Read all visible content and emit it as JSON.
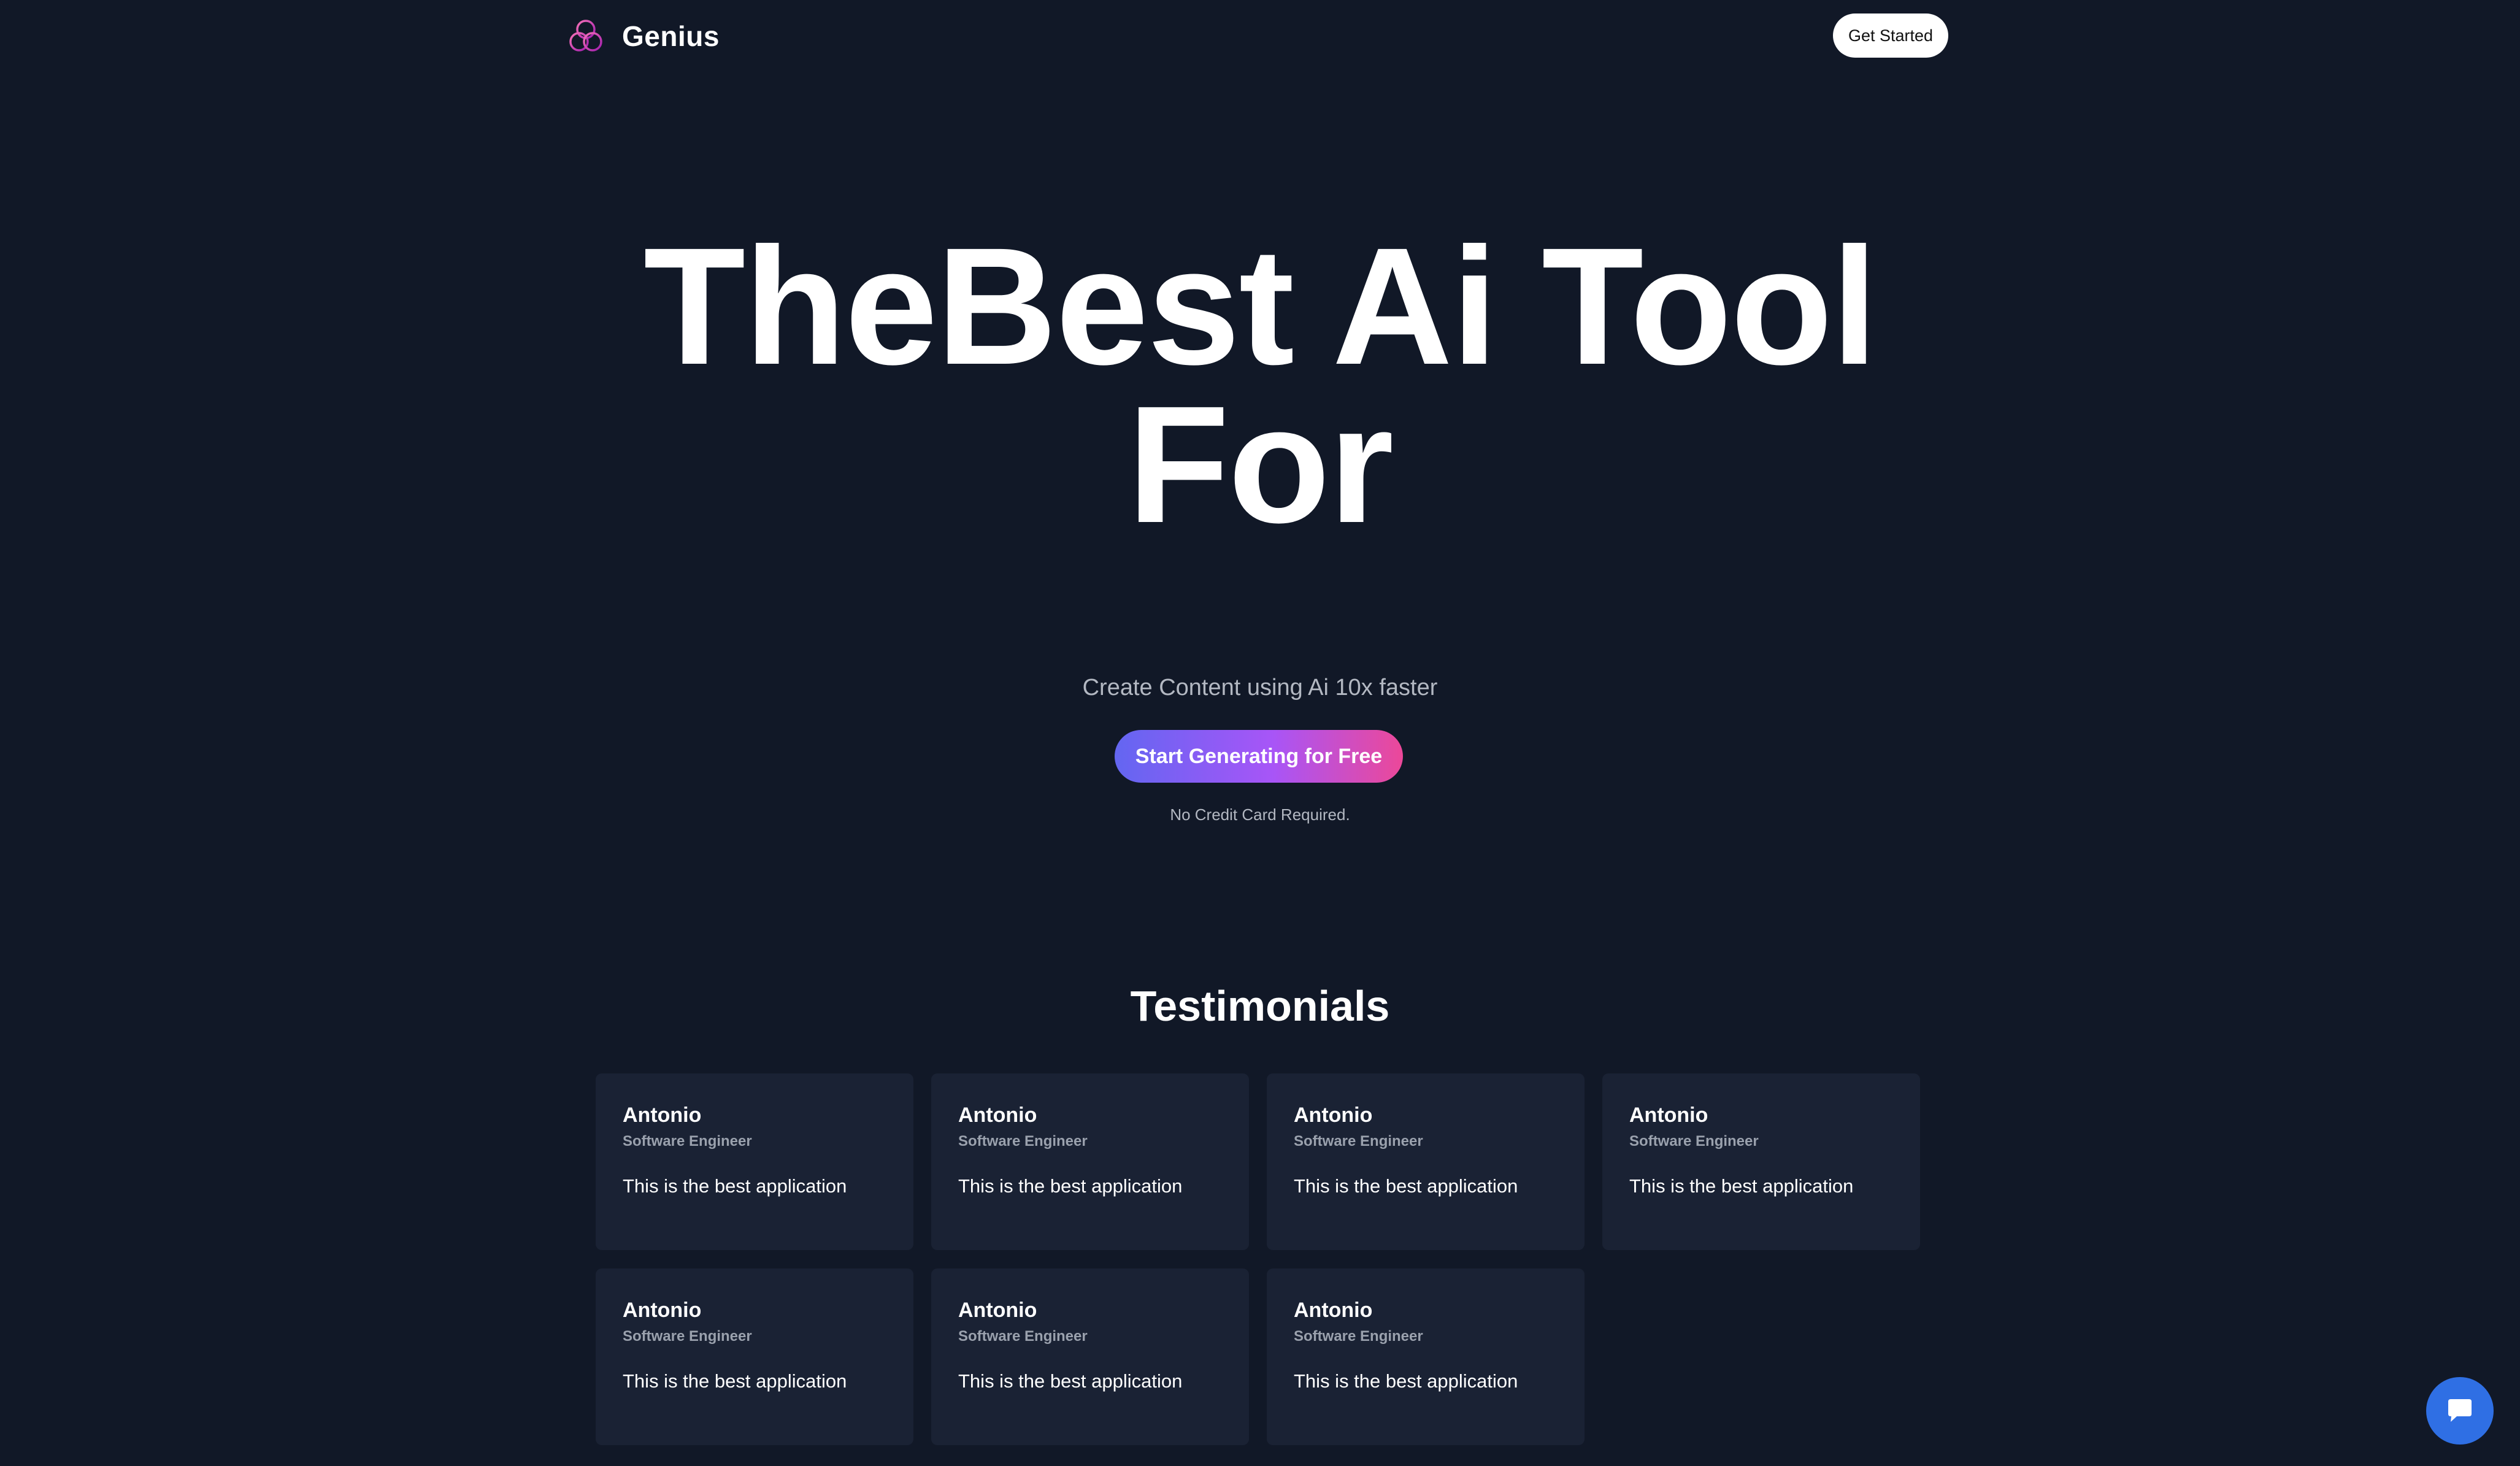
{
  "header": {
    "brand_name": "Genius",
    "logo_icon": "triple-ring-logo-icon",
    "get_started_label": "Get Started"
  },
  "hero": {
    "title_line1": "TheBest Ai Tool",
    "title_line2": "For",
    "subtitle": "Create Content using Ai 10x faster",
    "cta_label": "Start Generating for Free",
    "note": "No Credit Card Required."
  },
  "testimonials": {
    "heading": "Testimonials",
    "items": [
      {
        "name": "Antonio",
        "role": "Software Engineer",
        "quote": "This is the best application"
      },
      {
        "name": "Antonio",
        "role": "Software Engineer",
        "quote": "This is the best application"
      },
      {
        "name": "Antonio",
        "role": "Software Engineer",
        "quote": "This is the best application"
      },
      {
        "name": "Antonio",
        "role": "Software Engineer",
        "quote": "This is the best application"
      },
      {
        "name": "Antonio",
        "role": "Software Engineer",
        "quote": "This is the best application"
      },
      {
        "name": "Antonio",
        "role": "Software Engineer",
        "quote": "This is the best application"
      },
      {
        "name": "Antonio",
        "role": "Software Engineer",
        "quote": "This is the best application"
      }
    ]
  },
  "chat": {
    "icon": "chat-bubble-icon"
  },
  "colors": {
    "background": "#111827",
    "card": "#1a2234",
    "gradient_start": "#6366f1",
    "gradient_mid": "#a855f7",
    "gradient_end": "#ec4899",
    "chat_button": "#2f6fe4"
  }
}
